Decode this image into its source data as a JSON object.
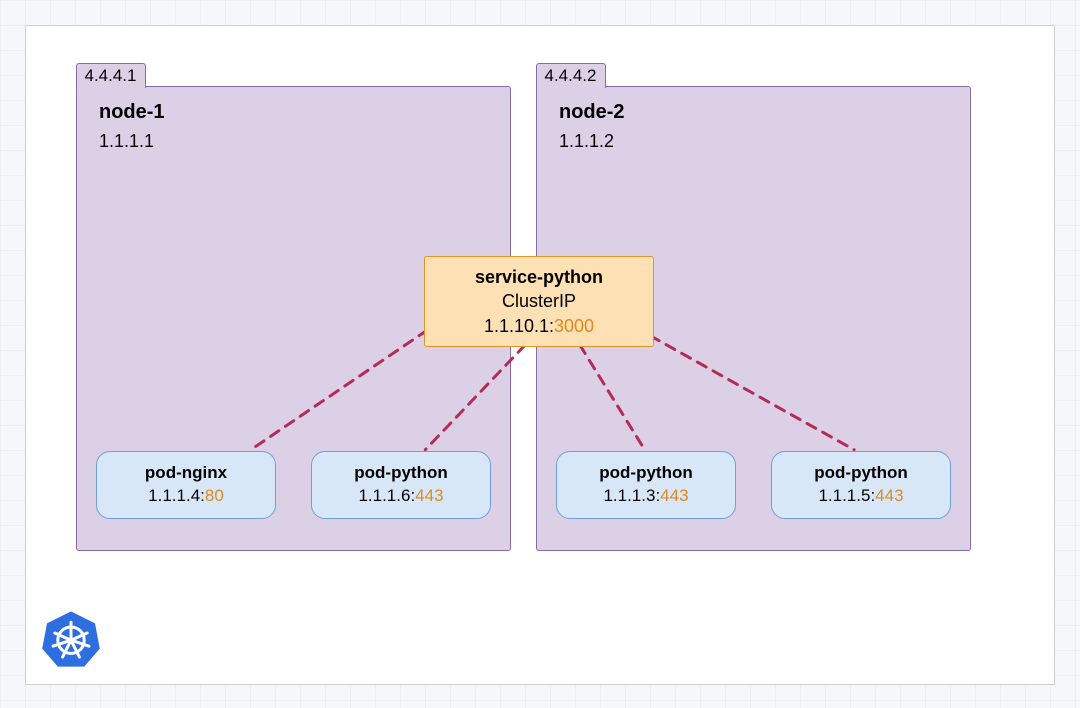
{
  "nodes": [
    {
      "id": "node-1",
      "name": "node-1",
      "external_ip": "4.4.4.1",
      "internal_ip": "1.1.1.1"
    },
    {
      "id": "node-2",
      "name": "node-2",
      "external_ip": "4.4.4.2",
      "internal_ip": "1.1.1.2"
    }
  ],
  "service": {
    "name": "service-python",
    "type": "ClusterIP",
    "ip": "1.1.10.1",
    "port": "3000"
  },
  "pods": [
    {
      "id": "pod-nginx",
      "name": "pod-nginx",
      "ip": "1.1.1.4",
      "port": "80"
    },
    {
      "id": "pod-python-1",
      "name": "pod-python",
      "ip": "1.1.1.6",
      "port": "443"
    },
    {
      "id": "pod-python-2",
      "name": "pod-python",
      "ip": "1.1.1.3",
      "port": "443"
    },
    {
      "id": "pod-python-3",
      "name": "pod-python",
      "ip": "1.1.1.5",
      "port": "443"
    }
  ],
  "colors": {
    "node_fill": "#dcd0e6",
    "node_border": "#8a6aa3",
    "service_fill": "#fde0b3",
    "service_border": "#e1962a",
    "pod_fill": "#d7e7f8",
    "pod_border": "#6f9fd8",
    "link": "#b42b56",
    "port_highlight": "#e08a1e"
  },
  "links": [
    {
      "from": "service",
      "to": "pod-nginx"
    },
    {
      "from": "service",
      "to": "pod-python-1"
    },
    {
      "from": "service",
      "to": "pod-python-2"
    },
    {
      "from": "service",
      "to": "pod-python-3"
    }
  ]
}
